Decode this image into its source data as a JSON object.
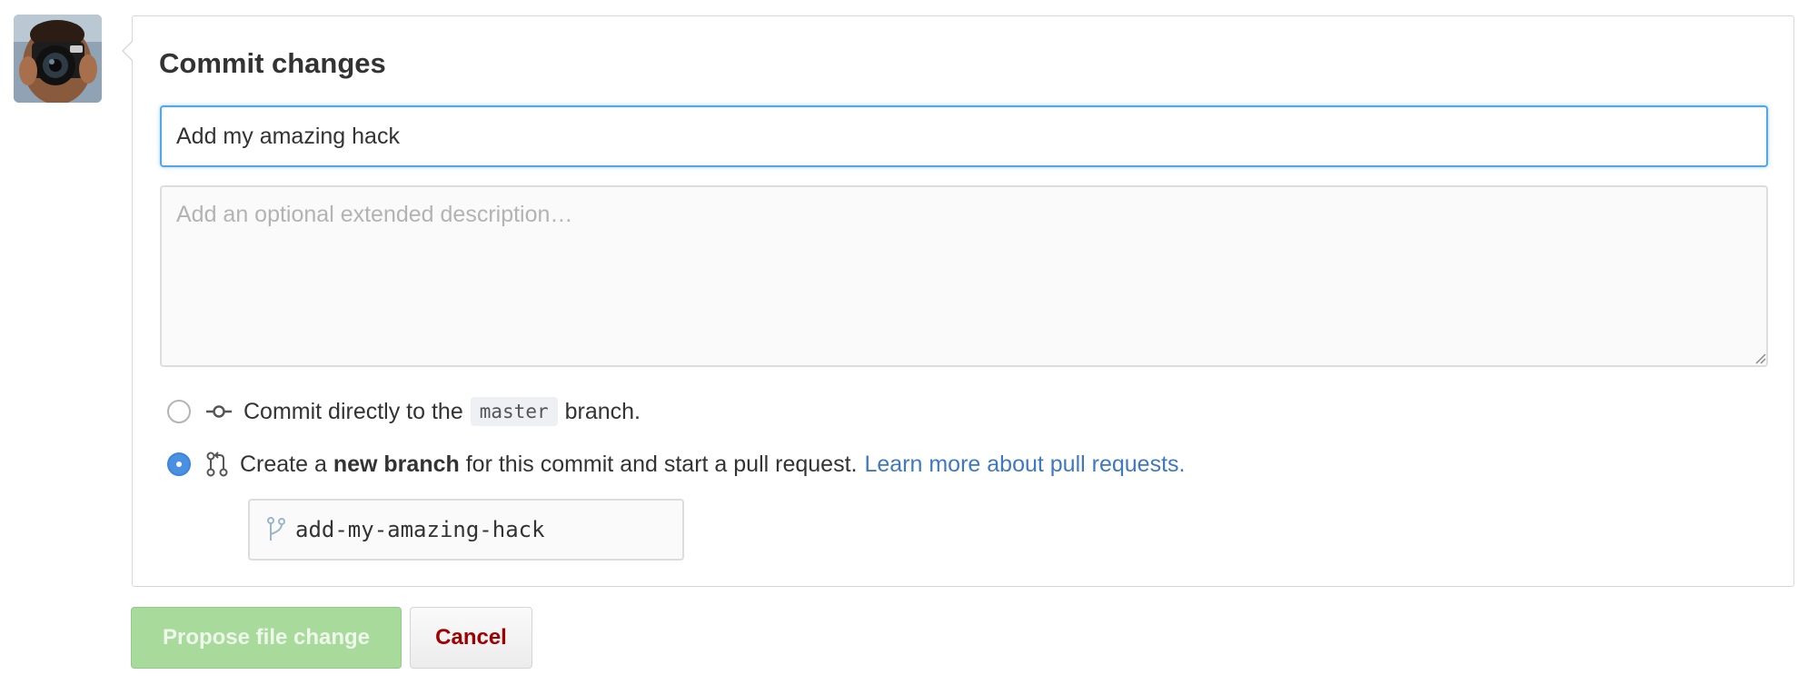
{
  "commit_form": {
    "title": "Commit changes",
    "summary_value": "Add my amazing hack",
    "description_placeholder": "Add an optional extended description…"
  },
  "options": {
    "direct": {
      "selected": false,
      "text_before": "Commit directly to the",
      "branch": "master",
      "text_after": "branch."
    },
    "new_branch": {
      "selected": true,
      "text_before": "Create a",
      "bold": "new branch",
      "text_after": "for this commit and start a pull request.",
      "link": "Learn more about pull requests."
    }
  },
  "branch_name_value": "add-my-amazing-hack",
  "buttons": {
    "propose": "Propose file change",
    "cancel": "Cancel"
  },
  "colors": {
    "focus_border": "#51a7e8",
    "link": "#4078c0",
    "radio_selected": "#4a90e2",
    "propose_button_disabled": "#a8da9c",
    "cancel_text": "#a00000"
  },
  "icons": {
    "commit": "git-commit-icon",
    "pull_request": "git-pull-request-icon",
    "branch": "git-branch-icon"
  }
}
